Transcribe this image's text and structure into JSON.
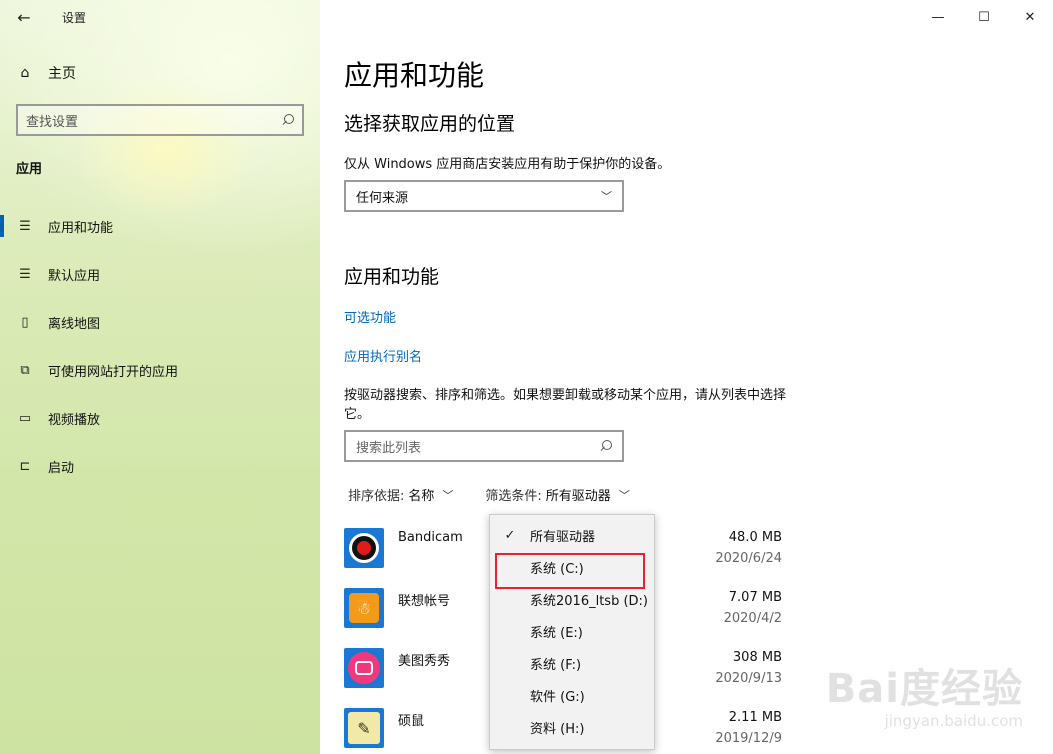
{
  "window": {
    "app_title": "设置",
    "back_glyph": "←",
    "minimize_glyph": "—",
    "maximize_glyph": "☐",
    "close_glyph": "✕"
  },
  "sidebar": {
    "home_label": "主页",
    "search_placeholder": "查找设置",
    "section_label": "应用",
    "items": [
      {
        "label": "应用和功能",
        "icon": "apps-features-icon",
        "glyph": "☰",
        "active": true
      },
      {
        "label": "默认应用",
        "icon": "default-apps-icon",
        "glyph": "☰",
        "active": false
      },
      {
        "label": "离线地图",
        "icon": "offline-maps-icon",
        "glyph": "▯",
        "active": false
      },
      {
        "label": "可使用网站打开的应用",
        "icon": "apps-for-websites-icon",
        "glyph": "⧉",
        "active": false
      },
      {
        "label": "视频播放",
        "icon": "video-playback-icon",
        "glyph": "▭",
        "active": false
      },
      {
        "label": "启动",
        "icon": "startup-icon",
        "glyph": "⊏",
        "active": false
      }
    ]
  },
  "main": {
    "page_title": "应用和功能",
    "choose_location_title": "选择获取应用的位置",
    "choose_location_desc": "仅从 Windows 应用商店安装应用有助于保护你的设备。",
    "source_select_value": "任何来源",
    "apps_features_title": "应用和功能",
    "optional_features_link": "可选功能",
    "app_alias_link": "应用执行别名",
    "list_desc": "按驱动器搜索、排序和筛选。如果想要卸载或移动某个应用，请从列表中选择它。",
    "list_search_placeholder": "搜索此列表",
    "sort_label": "排序依据:",
    "sort_value": "名称",
    "filter_label": "筛选条件:",
    "filter_value": "所有驱动器"
  },
  "apps": [
    {
      "name": "Bandicam",
      "size": "48.0 MB",
      "date": "2020/6/24",
      "icon": "bandicam-icon"
    },
    {
      "name": "联想帐号",
      "size": "7.07 MB",
      "date": "2020/4/2",
      "icon": "lenovo-id-icon"
    },
    {
      "name": "美图秀秀",
      "size": "308 MB",
      "date": "2020/9/13",
      "icon": "meitu-icon"
    },
    {
      "name": "硕鼠",
      "size": "2.11 MB",
      "date": "2019/12/9",
      "icon": "shuoshu-icon"
    }
  ],
  "filter_dropdown": {
    "options": [
      "所有驱动器",
      "系统 (C:)",
      "系统2016_ltsb (D:)",
      "系统 (E:)",
      "系统 (F:)",
      "软件 (G:)",
      "资料 (H:)"
    ],
    "selected": "所有驱动器",
    "highlighted": "系统 (C:)",
    "highlight_color": "#e3242b"
  },
  "colors": {
    "accent": "#0063b1",
    "link": "#0067b8"
  },
  "watermark": {
    "logo": "Bai度经验",
    "sub": "jingyan.baidu.com"
  }
}
